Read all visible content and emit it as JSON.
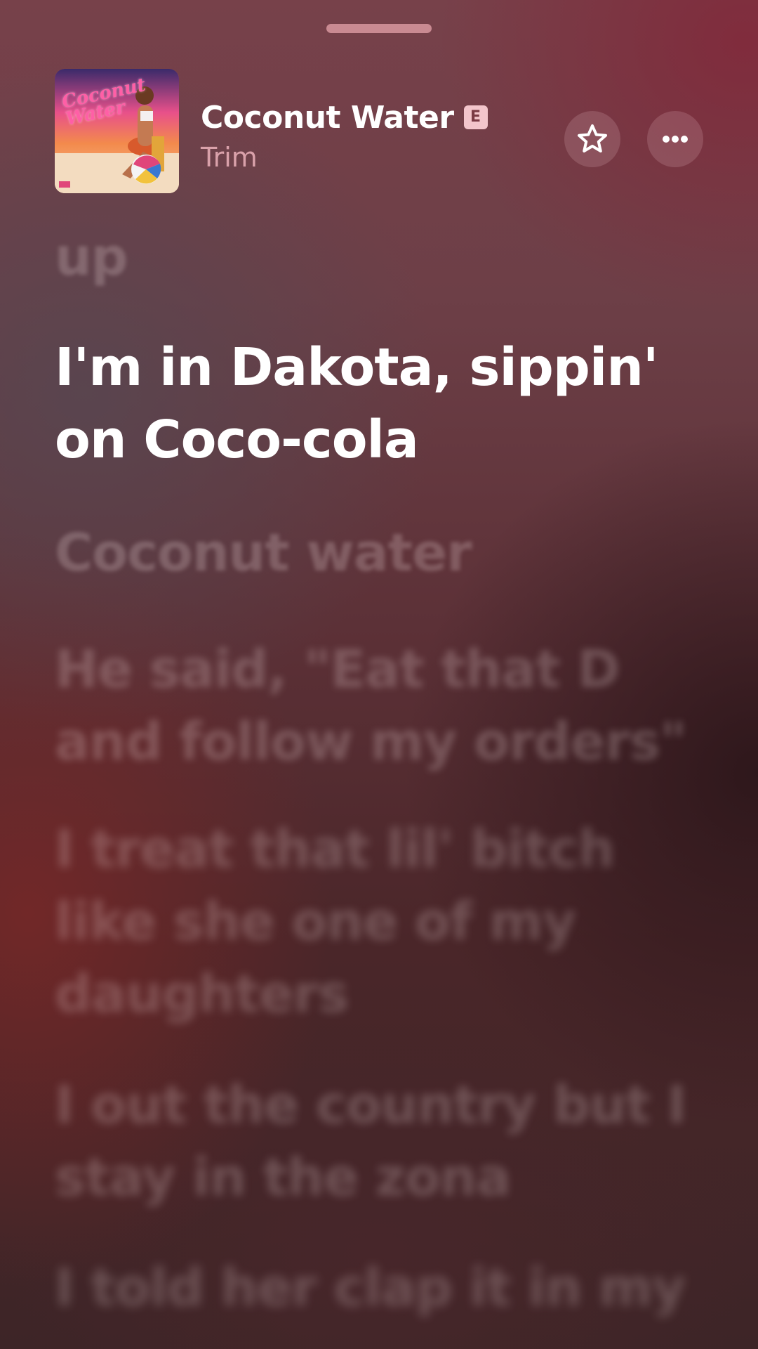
{
  "now_playing": {
    "title": "Coconut Water",
    "explicit_badge": "E",
    "artist": "Trim",
    "artwork": {
      "title_text": "Coconut Water"
    }
  },
  "icons": {
    "favorite": "star-icon",
    "more": "ellipsis-icon"
  },
  "lyrics": {
    "previous": "up",
    "current": "I'm in Dakota, sippin' on Coco-cola",
    "upcoming": [
      "Coconut water",
      "He said, \"Eat that D and follow my orders\"",
      "I treat that lil' bitch like she one of my daughters",
      "I out the country but I stay in the zona",
      "I told her clap it in my"
    ]
  },
  "colors": {
    "explicit_badge_bg": "#f3c5cb",
    "artist_text": "#d9a1aa",
    "current_lyric": "#ffffff"
  }
}
